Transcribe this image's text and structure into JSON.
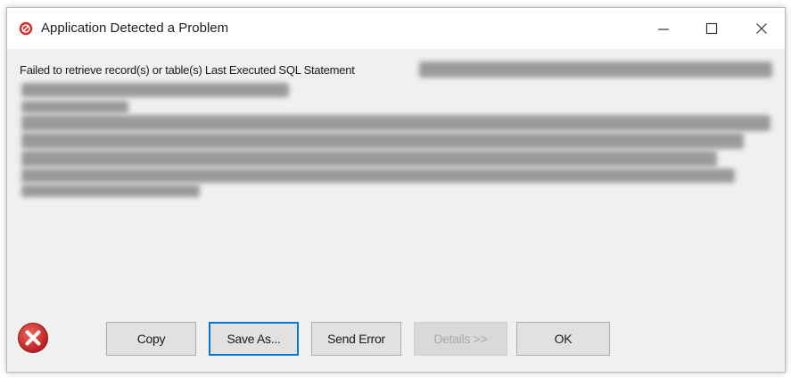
{
  "window": {
    "title": "Application Detected a Problem"
  },
  "message": {
    "text": "Failed to retrieve record(s) or table(s) Last Executed SQL Statement"
  },
  "buttons": {
    "copy": "Copy",
    "save_as": "Save As...",
    "send_error": "Send Error",
    "details": "Details >>",
    "ok": "OK"
  },
  "colors": {
    "error_red": "#c62828",
    "focus_blue": "#0078d7"
  },
  "icons": {
    "title": "stop-sign-icon",
    "dialog": "error-icon"
  }
}
